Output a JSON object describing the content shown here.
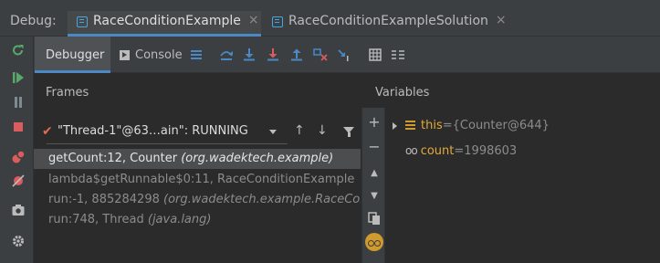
{
  "header": {
    "debug_label": "Debug:",
    "tabs": [
      {
        "label": "RaceConditionExample",
        "active": true
      },
      {
        "label": "RaceConditionExampleSolution",
        "active": false
      }
    ],
    "close_glyph": "×"
  },
  "toolbar": {
    "tabs": [
      {
        "label": "Debugger",
        "active": true
      },
      {
        "label": "Console",
        "active": false
      }
    ],
    "icons": [
      "menu-icon",
      "show-execution-point-icon",
      "step-over-icon",
      "step-into-icon",
      "force-step-into-icon",
      "step-out-icon",
      "drop-frame-icon",
      "run-to-cursor-icon",
      "evaluate-expression-icon",
      "trace-icon"
    ]
  },
  "left_tools": [
    "rerun-icon",
    "resume-icon",
    "pause-icon",
    "stop-icon",
    "view-breakpoints-icon",
    "mute-breakpoints-icon",
    "camera-icon",
    "settings-icon"
  ],
  "frames": {
    "title": "Frames",
    "thread": {
      "text": "\"Thread-1\"@63…ain\": RUNNING"
    },
    "up_glyph": "↑",
    "down_glyph": "↓",
    "rows": [
      {
        "text": "getCount:12, Counter ",
        "pkg": "(org.wadektech.example)",
        "selected": true
      },
      {
        "text": "lambda$getRunnable$0:11, RaceConditionExample",
        "pkg": "",
        "selected": false
      },
      {
        "text": "run:-1, 885284298 ",
        "pkg": "(org.wadektech.example.RaceCon",
        "selected": false
      },
      {
        "text": "run:748, Thread ",
        "pkg": "(java.lang)",
        "selected": false
      }
    ]
  },
  "mid_tools": {
    "plus": "+",
    "minus": "−",
    "up": "▲",
    "down": "▼"
  },
  "variables": {
    "title": "Variables",
    "items": [
      {
        "name": "this",
        "sep": " = ",
        "value": "{Counter@644}",
        "icon": "field-icon"
      },
      {
        "name": "count",
        "sep": " = ",
        "value": "1998603",
        "icon": "glasses-icon"
      }
    ]
  },
  "colors": {
    "accent": "#4a88c7",
    "field": "#d19a2c",
    "thread_check": "#e06c4f"
  }
}
